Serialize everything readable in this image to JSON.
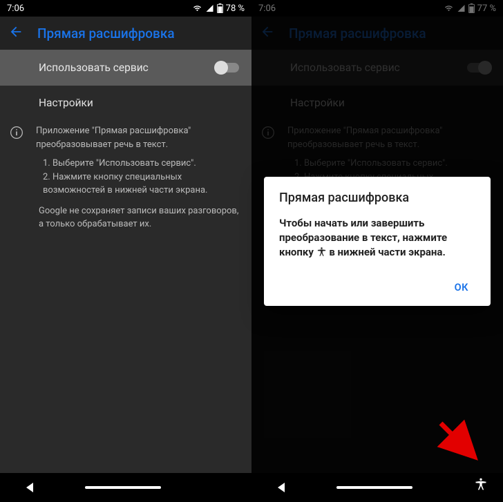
{
  "left": {
    "status": {
      "time": "7:06",
      "battery": "78 %"
    },
    "app_title": "Прямая расшифровка",
    "use_service_label": "Использовать сервис",
    "settings_label": "Настройки",
    "info_intro": "Приложение \"Прямая расшифровка\" преобразовывает речь в текст.",
    "info_step1": "1. Выберите \"Использовать сервис\".",
    "info_step2": "2. Нажмите кнопку специальных возможностей в нижней части экрана.",
    "info_note": "Google не сохраняет записи ваших разговоров, а только обрабатывает их."
  },
  "right": {
    "status": {
      "time": "7:06",
      "battery": "77 %"
    },
    "app_title": "Прямая расшифровка",
    "use_service_label": "Использовать сервис",
    "settings_label": "Настройки",
    "info_intro": "Приложение \"Прямая расшифровка\" преобразовывает речь в текст.",
    "info_step1": "1. Выберите \"Использовать сервис\".",
    "info_step2": "2. Нажмите кнопку специальных возможностей",
    "dialog_title": "Прямая расшифровка",
    "dialog_body_a": "Чтобы начать или завершить преобразование в текст, нажмите кнопку ",
    "dialog_body_b": " в нижней части экрана.",
    "dialog_ok": "ОК"
  }
}
